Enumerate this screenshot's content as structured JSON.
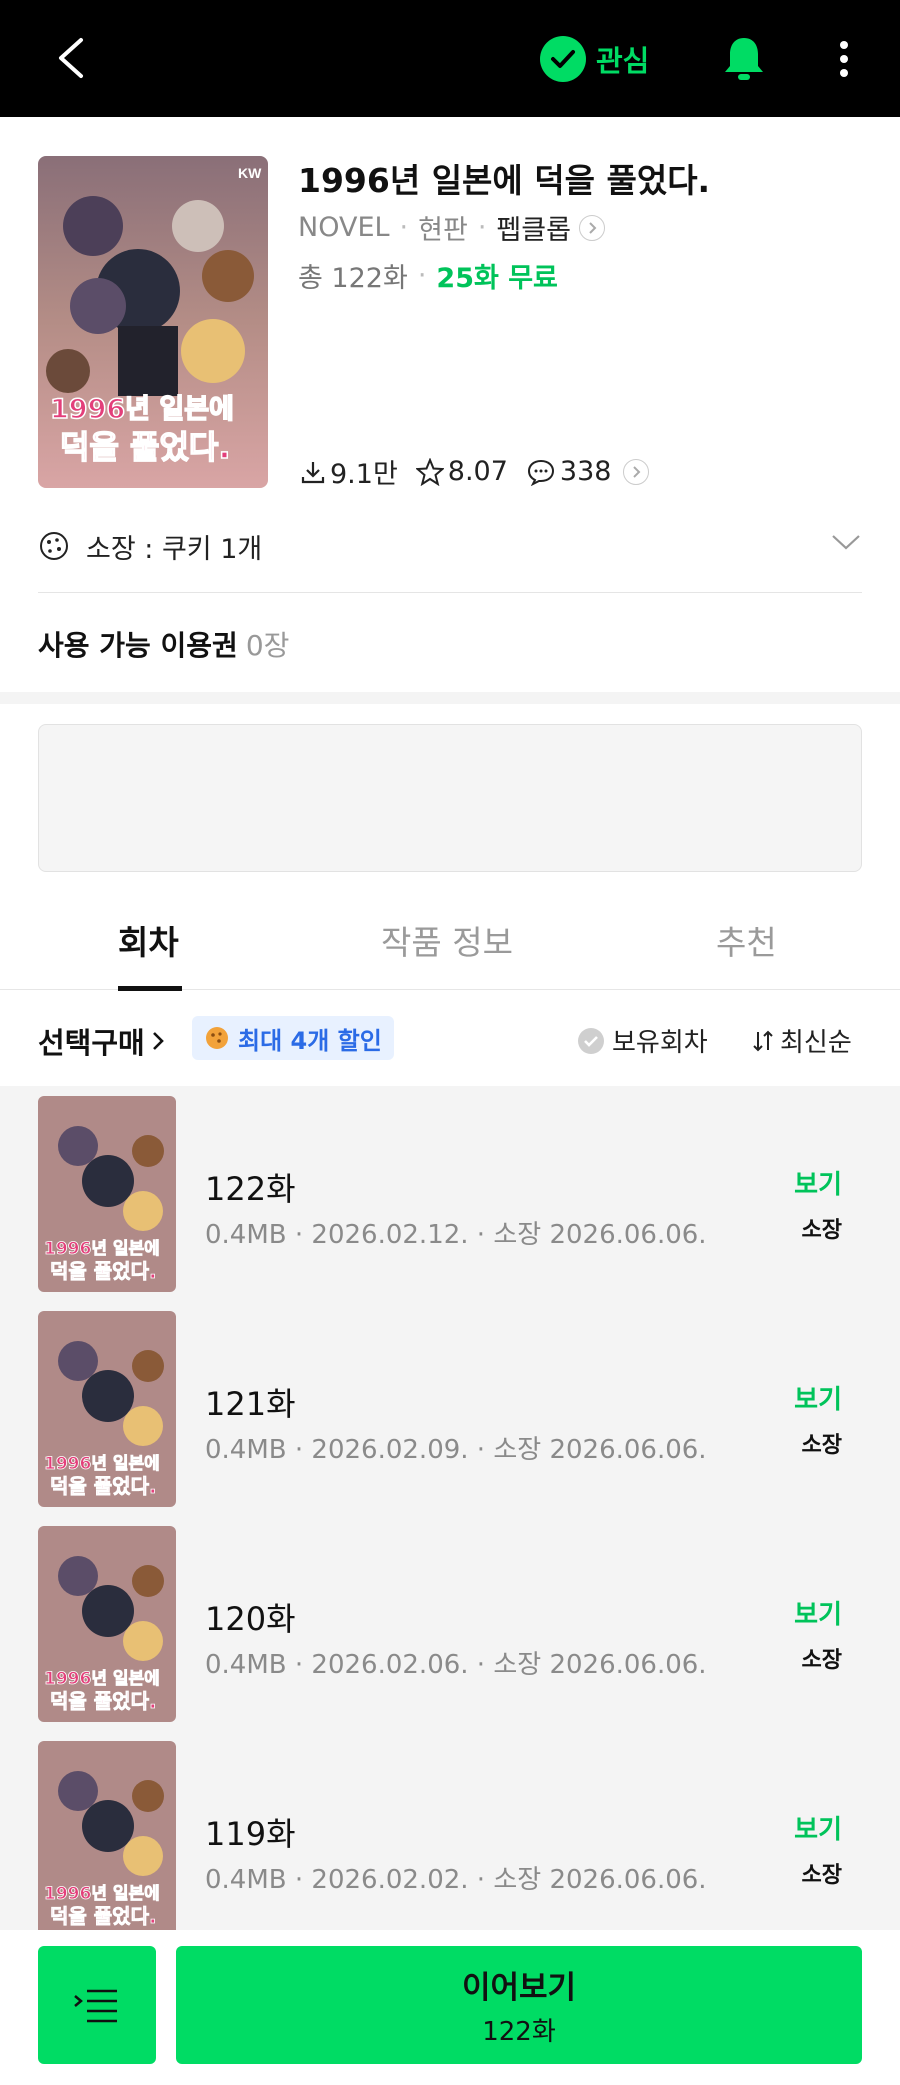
{
  "header": {
    "favorite_label": "관심"
  },
  "book": {
    "title": "1996년 일본에 덕을 풀었다.",
    "type": "NOVEL",
    "genre": "현판",
    "publisher": "펩클롭",
    "total_episodes": "총 122화",
    "free_episodes": "25화 무료",
    "cover_badge": "KW",
    "cover_title_line1": "1996년 일본에",
    "cover_title_line2": "덕을 풀었다.",
    "downloads": "9.1만",
    "rating": "8.07",
    "comments": "338"
  },
  "ownership": {
    "label": "소장 : 쿠키 1개"
  },
  "tickets": {
    "label": "사용 가능 이용권",
    "count": "0장"
  },
  "tabs": [
    "회차",
    "작품 정보",
    "추천"
  ],
  "filters": {
    "select_buy": "선택구매",
    "discount": "최대 4개 할인",
    "owned": "보유회차",
    "sort": "최신순"
  },
  "episodes": [
    {
      "title": "122화",
      "meta": "0.4MB · 2026.02.12. · 소장 2026.06.06.",
      "view": "보기",
      "own": "소장"
    },
    {
      "title": "121화",
      "meta": "0.4MB · 2026.02.09. · 소장 2026.06.06.",
      "view": "보기",
      "own": "소장"
    },
    {
      "title": "120화",
      "meta": "0.4MB · 2026.02.06. · 소장 2026.06.06.",
      "view": "보기",
      "own": "소장"
    },
    {
      "title": "119화",
      "meta": "0.4MB · 2026.02.02. · 소장 2026.06.06.",
      "view": "보기",
      "own": "소장"
    }
  ],
  "bottom": {
    "continue_label": "이어보기",
    "continue_episode": "122화"
  },
  "colors": {
    "accent_green": "#00dc64",
    "free_green": "#00c35a",
    "badge_blue": "#2b6be6"
  }
}
